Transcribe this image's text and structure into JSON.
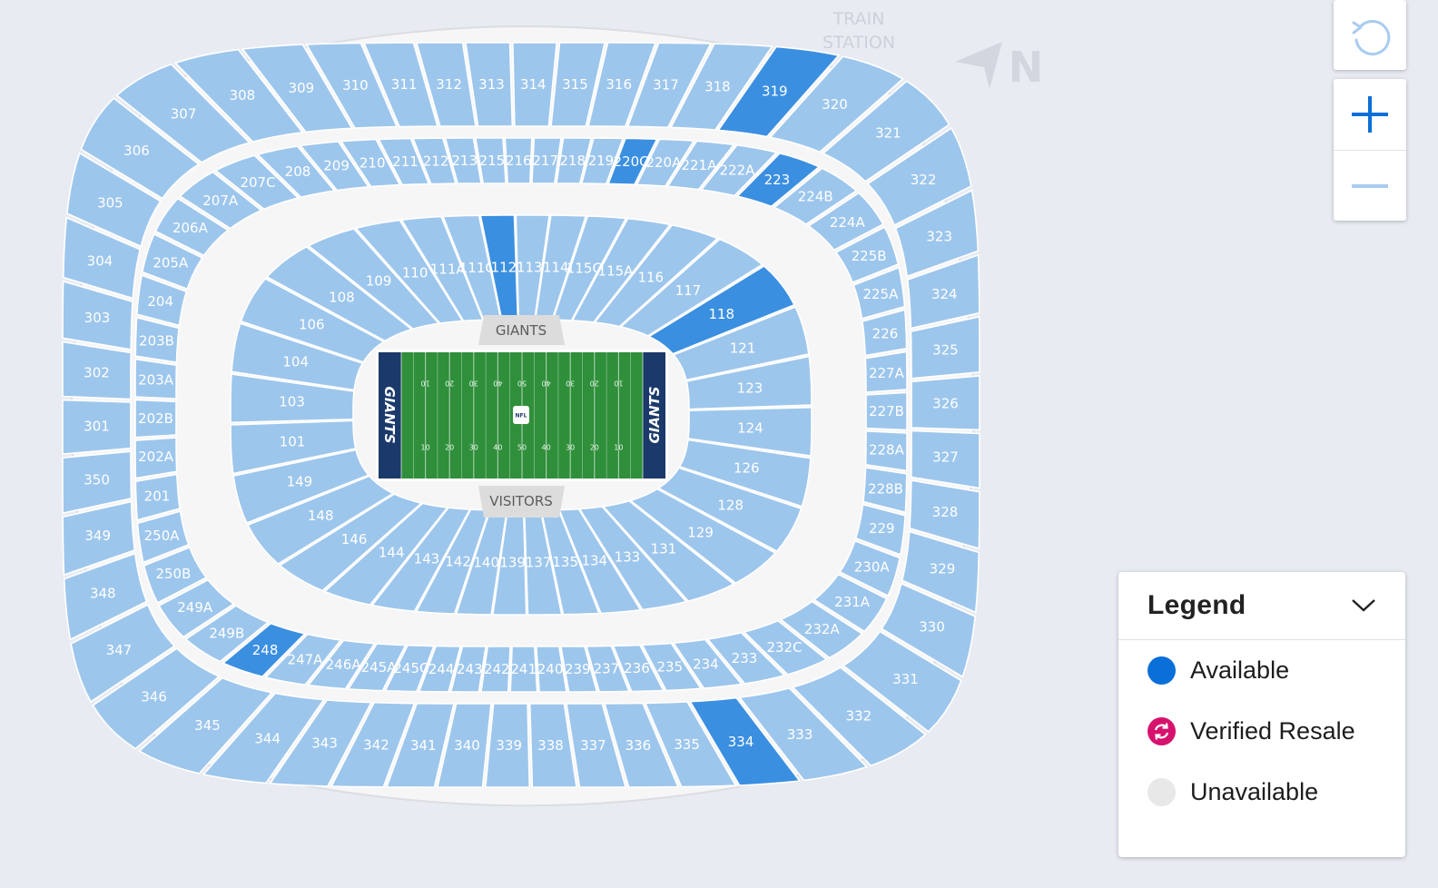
{
  "map": {
    "landmark_line1": "TRAIN",
    "landmark_line2": "STATION",
    "north_label": "N",
    "end_zone_top": "GIANTS",
    "end_zone_bottom": "VISITORS",
    "endzone_text": "GIANTS",
    "field_badge": "NFL",
    "yard_markers_top": [
      "10",
      "20",
      "30",
      "40",
      "50",
      "40",
      "30",
      "20",
      "10"
    ],
    "yard_markers_bottom": [
      "10",
      "20",
      "30",
      "40",
      "50",
      "40",
      "30",
      "20",
      "10"
    ],
    "available_sections": [
      "319",
      "220C",
      "112",
      "118",
      "223",
      "248",
      "334"
    ],
    "ring_300": [
      "307",
      "308",
      "309",
      "310",
      "311",
      "312",
      "313",
      "314",
      "315",
      "316",
      "317",
      "318",
      "319",
      "320",
      "321",
      "322",
      "323",
      "324",
      "325",
      "326",
      "327",
      "328",
      "329",
      "330",
      "331",
      "332",
      "333",
      "334",
      "335",
      "336",
      "337",
      "338",
      "339",
      "340",
      "341",
      "342",
      "343",
      "344",
      "345",
      "346",
      "347",
      "348",
      "349",
      "350",
      "301",
      "302",
      "303",
      "304",
      "305",
      "306"
    ],
    "ring_200": [
      "208",
      "209",
      "210",
      "211",
      "212",
      "213",
      "215",
      "216",
      "217",
      "218",
      "219",
      "220C",
      "220A",
      "221A",
      "222A",
      "223",
      "224B",
      "224A",
      "225B",
      "225A",
      "226",
      "227A",
      "227B",
      "228A",
      "228B",
      "229",
      "230A",
      "231A",
      "232A",
      "232C",
      "233",
      "234",
      "235",
      "236",
      "237",
      "239",
      "240",
      "241",
      "242",
      "243",
      "244",
      "245C",
      "245A",
      "246A",
      "247A",
      "248",
      "249B",
      "249A",
      "250B",
      "250A",
      "201",
      "202A",
      "202B",
      "203A",
      "203B",
      "204",
      "205A",
      "206A",
      "207A",
      "207C"
    ],
    "ring_100": [
      "113",
      "114",
      "115C",
      "115A",
      "116",
      "117",
      "118",
      "121",
      "123",
      "124",
      "126",
      "128",
      "129",
      "131",
      "133",
      "134",
      "135",
      "137",
      "139",
      "140",
      "142",
      "143",
      "144",
      "146",
      "148",
      "149",
      "101",
      "103",
      "104",
      "106",
      "108",
      "109",
      "110",
      "111A",
      "111C",
      "112"
    ]
  },
  "controls": {
    "reset_icon": "rotate-ccw-icon",
    "zoom_in_icon": "plus-icon",
    "zoom_out_icon": "minus-icon"
  },
  "legend": {
    "title": "Legend",
    "items": [
      {
        "label": "Available",
        "color": "#0a6fd8",
        "icon": "filled-circle"
      },
      {
        "label": "Verified Resale",
        "color": "#d6126e",
        "icon": "resale-arrows-icon"
      },
      {
        "label": "Unavailable",
        "color": "#e8e8e8",
        "icon": "filled-circle"
      }
    ]
  },
  "colors": {
    "section": "#9dc6ec",
    "available": "#3b8fe0",
    "field": "#2f8f3a",
    "endzone": "#1b3a6b",
    "concourse": "#f5f5f6"
  }
}
